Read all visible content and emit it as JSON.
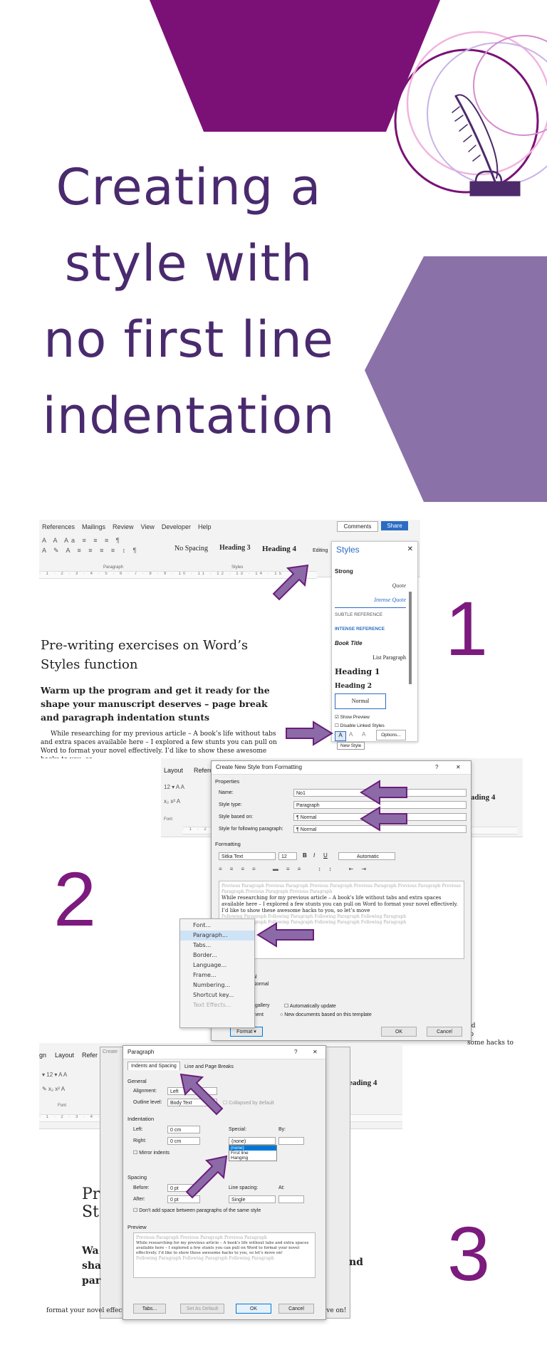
{
  "title": {
    "line1": "Creating a",
    "line2": "style with",
    "line3": "no first line",
    "line4": "indentation"
  },
  "colors": {
    "dark_purple": "#7b1176",
    "light_purple": "#8a72a9",
    "title_text": "#4a2a6e",
    "number": "#7c1a7e",
    "arrow_fill": "#8c6aa8",
    "arrow_stroke": "#6a1f7a"
  },
  "steps": {
    "one": "1",
    "two": "2",
    "three": "3"
  },
  "panel1": {
    "menu": [
      "References",
      "Mailings",
      "Review",
      "View",
      "Developer",
      "Help"
    ],
    "comments_btn": "Comments",
    "share_btn": "Share",
    "style_gallery": [
      "No Spacing",
      "Heading 3",
      "Heading 4"
    ],
    "editing": "Editing",
    "group_paragraph": "Paragraph",
    "group_styles": "Styles",
    "styles_pane": {
      "title": "Styles",
      "items": [
        "Strong",
        "Quote",
        "Intense Quote",
        "Subtle Reference",
        "Intense Reference",
        "Book Title",
        "List Paragraph",
        "Heading 1",
        "Heading 2",
        "Normal"
      ],
      "show_preview": "Show Preview",
      "disable_linked": "Disable Linked Styles",
      "options": "Options...",
      "tooltip": "New Style"
    },
    "doc_heading": "Pre-writing exercises on Word’s Styles function",
    "doc_subheading": "Warm up the program and get it ready for the shape your manuscript deserves – page break and paragraph indentation stunts",
    "doc_body": "While researching for my previous article – A book’s life without tabs and extra spaces available here – I explored a few stunts you can pull on Word to format your novel effectively. I’d like to show these awesome hacks to you, so"
  },
  "panel2": {
    "tabs": [
      "Layout",
      "Refere"
    ],
    "dialog_title": "Create New Style from Formatting",
    "help": "?",
    "close": "✕",
    "properties": "Properties",
    "name_label": "Name:",
    "name_value": "No1",
    "style_type_label": "Style type:",
    "style_type_value": "Paragraph",
    "based_on_label": "Style based on:",
    "based_on_value": "¶ Normal",
    "following_label": "Style for following paragraph:",
    "following_value": "¶ Normal",
    "formatting": "Formatting",
    "font_value": "Sitka Text",
    "size_value": "12",
    "color_value": "Automatic",
    "preview_prev": "Previous Paragraph Previous Paragraph Previous Paragraph Previous Paragraph Previous Paragraph Previous Paragraph Previous Paragraph Previous Paragraph",
    "preview_text": "While researching for my previous article – A book’s life without tabs and extra spaces available here – I explored a few stunts you can pull on Word to format your novel effectively. I’d like to show these awesome hacks to you, so let’s move",
    "preview_follow": "Following Paragraph Following Paragraph Following Paragraph Following Paragraph",
    "format_menu": [
      "Font...",
      "Paragraph...",
      "Tabs...",
      "Border...",
      "Language...",
      "Frame...",
      "Numbering...",
      "Shortcut key...",
      "Text Effects..."
    ],
    "desc1": "00",
    "desc2": "rmal",
    "desc3": "e: Normal",
    "add_gallery": "les gallery",
    "auto_update": "Automatically update",
    "only_doc": "cument",
    "new_docs": "New documents based on this template",
    "format_btn": "Format",
    "ok": "OK",
    "cancel": "Cancel",
    "heading_right": "eading 4",
    "font_group": "Font"
  },
  "panel3": {
    "tabs": [
      "gn",
      "Layout",
      "Refer"
    ],
    "dialog_title": "Paragraph",
    "help": "?",
    "close": "✕",
    "tab_indents": "Indents and Spacing",
    "tab_breaks": "Line and Page Breaks",
    "general": "General",
    "alignment_label": "Alignment:",
    "alignment_value": "Left",
    "outline_label": "Outline level:",
    "outline_value": "Body Text",
    "collapsed": "Collapsed by default",
    "indentation": "Indentation",
    "left_label": "Left:",
    "left_value": "0 cm",
    "right_label": "Right:",
    "right_value": "0 cm",
    "special_label": "Special:",
    "special_value": "(none)",
    "special_options": [
      "(none)",
      "First line",
      "Hanging"
    ],
    "by_label": "By:",
    "mirror": "Mirror indents",
    "spacing": "Spacing",
    "before_label": "Before:",
    "before_value": "0 pt",
    "after_label": "After:",
    "after_value": "0 pt",
    "line_spacing_label": "Line spacing:",
    "line_spacing_value": "Single",
    "at_label": "At:",
    "dont_add": "Don't add space between paragraphs of the same style",
    "preview": "Preview",
    "preview_text": "While researching for my previous article – A book’s life without tabs and extra spaces available here – I explored a few stunts you can pull on Word to format your novel effectively. I’d like to show these awesome hacks to you, so let’s move on!",
    "tabs_btn": "Tabs...",
    "set_default": "Set As Default",
    "ok": "OK",
    "cancel": "Cancel",
    "heading_right": "eading 4",
    "font_group": "Font",
    "create_label": "Create",
    "doc_body": "format your novel effectively. I’d like to show these awesome hacks to you, so let’s move on!"
  }
}
